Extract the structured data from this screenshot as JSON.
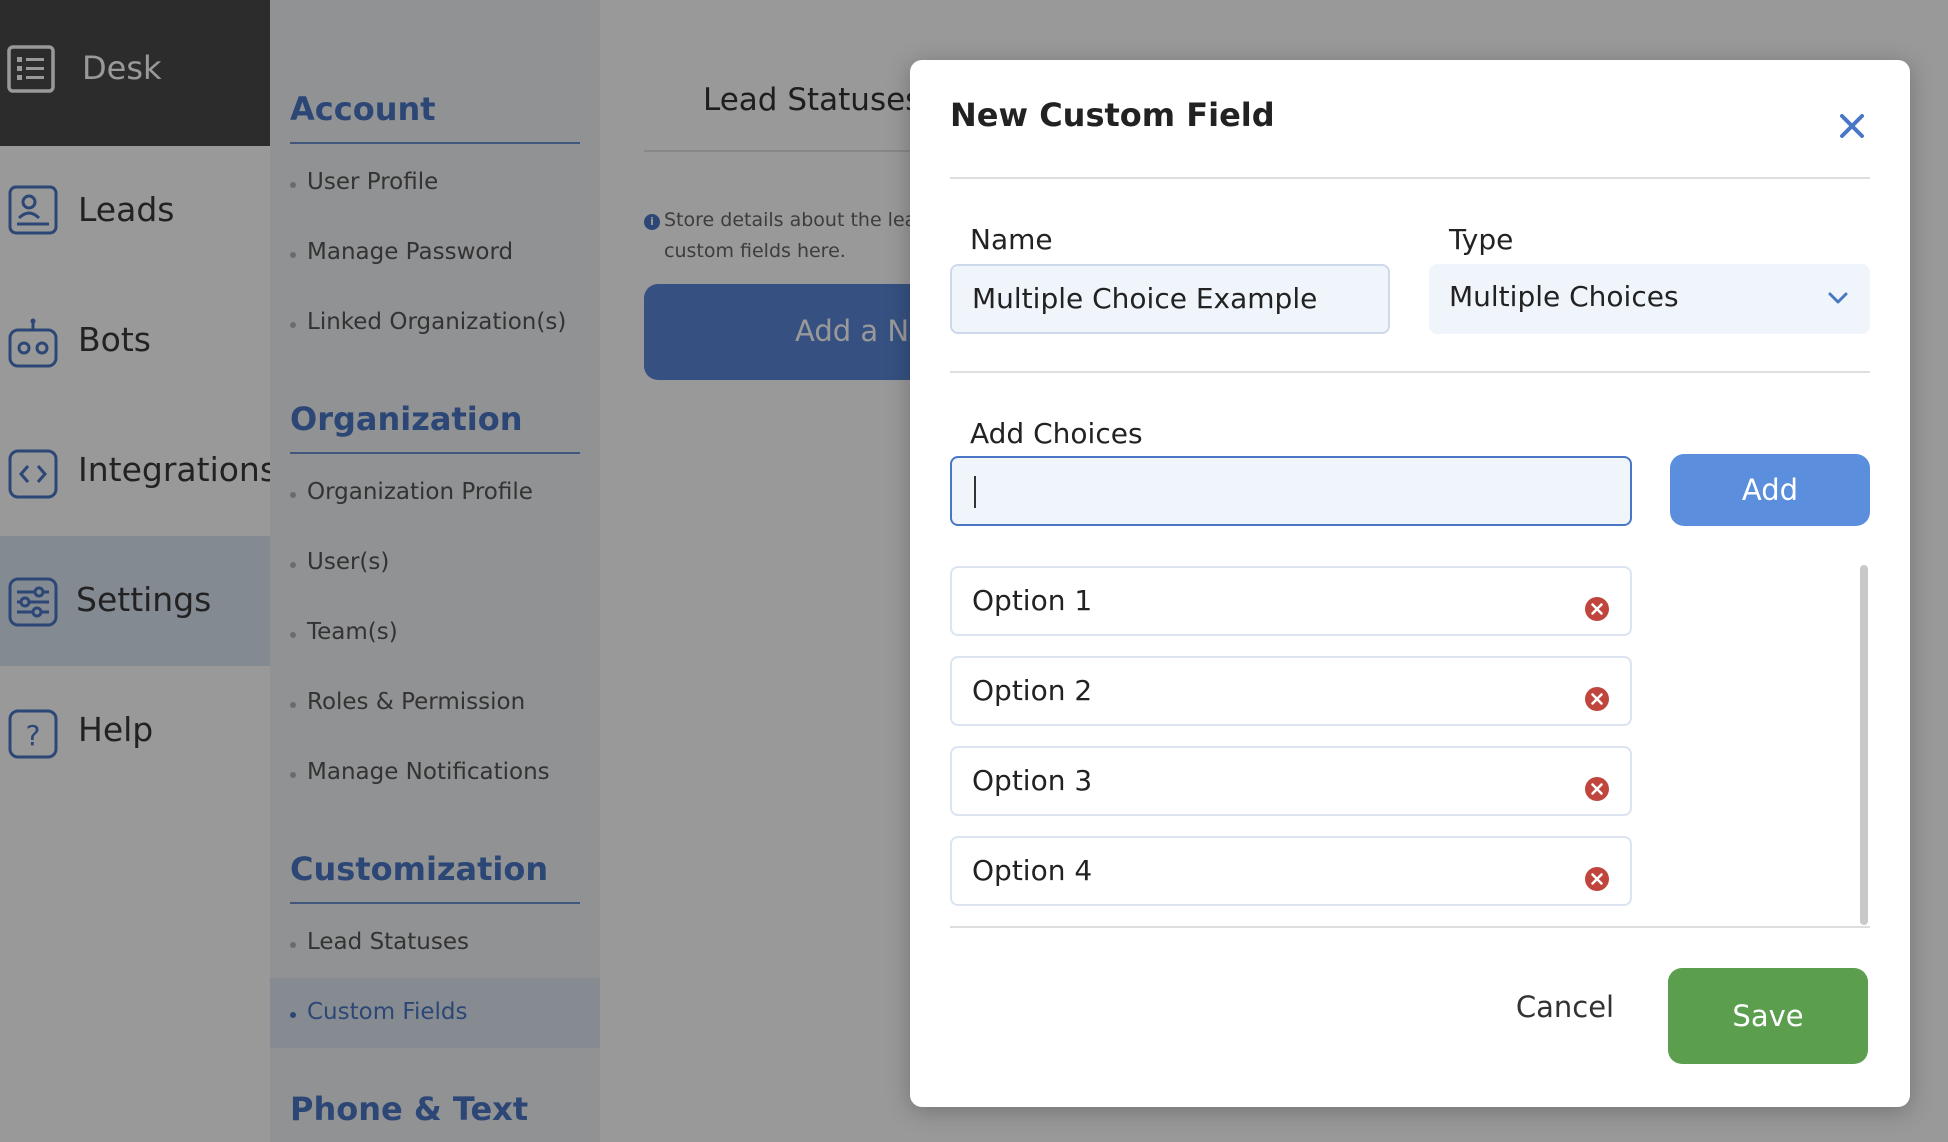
{
  "nav": {
    "desk": {
      "label": "Desk",
      "icon": "desk-icon"
    },
    "items": [
      {
        "label": "Leads",
        "icon": "leads-icon"
      },
      {
        "label": "Bots",
        "icon": "bot-icon"
      },
      {
        "label": "Integrations",
        "icon": "integrations-icon"
      },
      {
        "label": "Settings",
        "icon": "settings-sliders-icon",
        "active": true
      },
      {
        "label": "Help",
        "icon": "help-icon"
      }
    ]
  },
  "menu": {
    "sections": [
      {
        "title": "Account",
        "items": [
          "User Profile",
          "Manage Password",
          "Linked Organization(s)"
        ]
      },
      {
        "title": "Organization",
        "items": [
          "Organization Profile",
          "User(s)",
          "Team(s)",
          "Roles & Permission",
          "Manage Notifications"
        ]
      },
      {
        "title": "Customization",
        "items": [
          "Lead Statuses",
          "Custom Fields"
        ]
      },
      {
        "title": "Phone & Text",
        "items": []
      }
    ],
    "active_item": "Custom Fields"
  },
  "main": {
    "tab_title": "Lead Statuses",
    "info_line1": "Store details about the lead",
    "info_line2": "custom fields here.",
    "add_button_label": "Add a Ne"
  },
  "modal": {
    "title": "New Custom Field",
    "name_label": "Name",
    "name_value": "Multiple Choice Example",
    "type_label": "Type",
    "type_value": "Multiple Choices",
    "add_choices_label": "Add Choices",
    "choice_input_value": "",
    "add_button_label": "Add",
    "options": [
      "Option 1",
      "Option 2",
      "Option 3",
      "Option 4"
    ],
    "cancel_label": "Cancel",
    "save_label": "Save"
  },
  "colors": {
    "accent": "#4a77c5",
    "add_button": "#5b8fde",
    "save_button": "#5a9e4e",
    "remove_icon": "#c0453d",
    "desk_bg": "#4a4a4a"
  }
}
